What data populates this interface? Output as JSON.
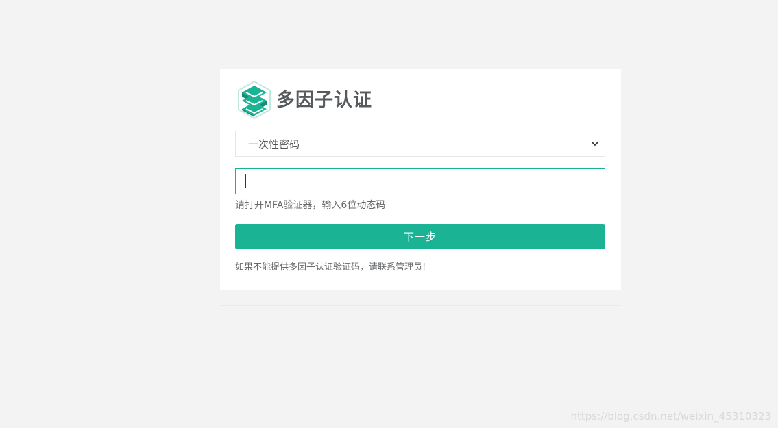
{
  "header": {
    "title": "多因子认证",
    "logo_icon": "stacked-layers-s-logo"
  },
  "form": {
    "method_select": {
      "selected": "一次性密码",
      "icon": "chevron-down-icon"
    },
    "otp_input": {
      "value": "",
      "placeholder": ""
    },
    "hint": "请打开MFA验证器，输入6位动态码",
    "next_button_label": "下一步",
    "footer_note": "如果不能提供多因子认证验证码，请联系管理员!"
  },
  "watermark": "https://blog.csdn.net/weixin_45310323",
  "colors": {
    "accent": "#1ab394",
    "background": "#f3f3f3",
    "card": "#ffffff"
  }
}
